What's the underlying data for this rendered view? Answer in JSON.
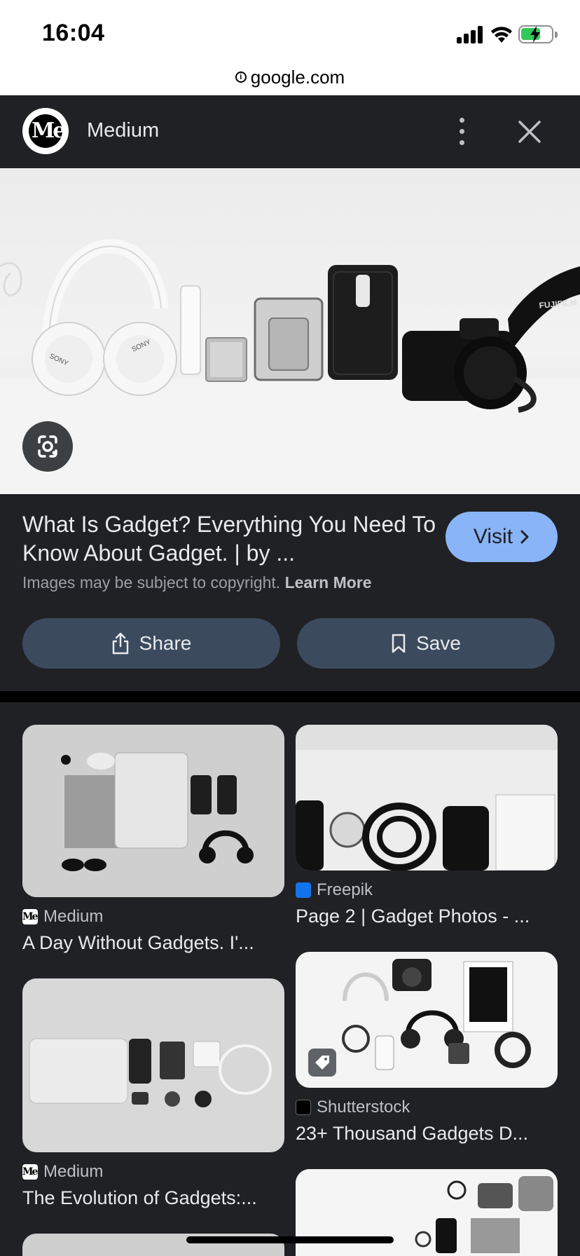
{
  "status_bar": {
    "time": "16:04"
  },
  "browser": {
    "url": "google.com"
  },
  "viewer": {
    "site_name": "Medium",
    "logo_text": "Me",
    "result_title": "What Is Gadget? Everything You Need To Know About Gadget. | by ...",
    "visit_label": "Visit",
    "copyright_text": "Images may be subject to copyright.",
    "learn_more_label": "Learn More",
    "share_label": "Share",
    "save_label": "Save",
    "hero_brand_text": "FUJIFILM"
  },
  "related": [
    {
      "source": "Medium",
      "title": "A Day Without Gadgets. I'...",
      "favicon": "Me"
    },
    {
      "source": "Freepik",
      "title": "Page 2 | Gadget Photos - ...",
      "favicon": "F"
    },
    {
      "source": "Medium",
      "title": "The Evolution of Gadgets:...",
      "favicon": "Me"
    },
    {
      "source": "Shutterstock",
      "title": "23+ Thousand Gadgets D...",
      "favicon": "S"
    }
  ],
  "colors": {
    "background": "#202124",
    "visit_button": "#8ab4f8",
    "action_button": "#3c4a5e",
    "battery": "#34c759"
  }
}
